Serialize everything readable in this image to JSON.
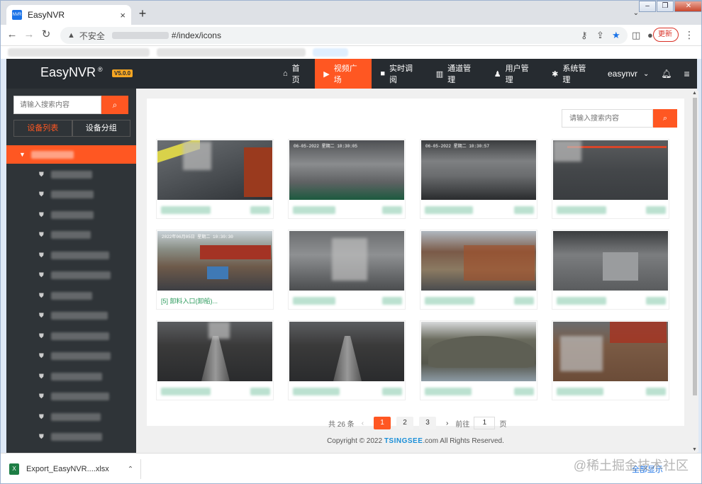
{
  "browser": {
    "tab_title": "EasyNVR",
    "tab_favicon": "nvr-favicon",
    "new_tab": "+",
    "close_tab": "×",
    "security_label": "不安全",
    "url_visible": "#/index/icons",
    "update_label": "更新",
    "window_controls": [
      "–",
      "❐",
      "✕"
    ]
  },
  "app": {
    "brand": "EasyNVR",
    "brand_reg": "®",
    "version": "V5.0.0",
    "nav": [
      {
        "label": "首页",
        "icon": "home-icon",
        "active": false
      },
      {
        "label": "视频广场",
        "icon": "play-circle-icon",
        "active": true
      },
      {
        "label": "实时调阅",
        "icon": "video-icon",
        "active": false
      },
      {
        "label": "通道管理",
        "icon": "list-icon",
        "active": false
      },
      {
        "label": "用户管理",
        "icon": "user-icon",
        "active": false
      },
      {
        "label": "系统管理",
        "icon": "gear-icon",
        "active": false
      }
    ],
    "user": "easynvr",
    "accent": "#ff5722",
    "nav_bg": "#262b30"
  },
  "sidebar": {
    "search_placeholder": "请输入搜索内容",
    "tabs": [
      {
        "label": "设备列表",
        "active": true
      },
      {
        "label": "设备分组",
        "active": false
      }
    ]
  },
  "content": {
    "search_placeholder": "请输入搜索内容",
    "cards": [
      {
        "timestamp": ""
      },
      {
        "timestamp": "06-05-2022  星期二  10:30:05"
      },
      {
        "timestamp": "06-05-2022  星期二  10:30:57"
      },
      {
        "timestamp": ""
      },
      {
        "timestamp": "2022年06月05日 星期二 10:30:30"
      },
      {
        "timestamp": ""
      },
      {
        "timestamp": ""
      },
      {
        "timestamp": ""
      },
      {
        "timestamp": ""
      },
      {
        "timestamp": ""
      },
      {
        "timestamp": ""
      },
      {
        "timestamp": ""
      }
    ],
    "card_label_5": "[5] 卸料入口(卸船)..."
  },
  "pagination": {
    "total": "共 26 条",
    "pages": [
      "1",
      "2",
      "3"
    ],
    "current": "1",
    "prev": "‹",
    "next": "›",
    "goto_label": "前往",
    "goto_value": "1",
    "page_suffix": "页"
  },
  "footer": {
    "copyright_pre": "Copyright © 2022 ",
    "copyright_logo": "TSINGSEE",
    "copyright_post": ".com All Rights Reserved."
  },
  "download": {
    "file_name": "Export_EasyNVR....xlsx",
    "show_all": "全部显示"
  },
  "watermark": "@稀土掘金技术社区"
}
